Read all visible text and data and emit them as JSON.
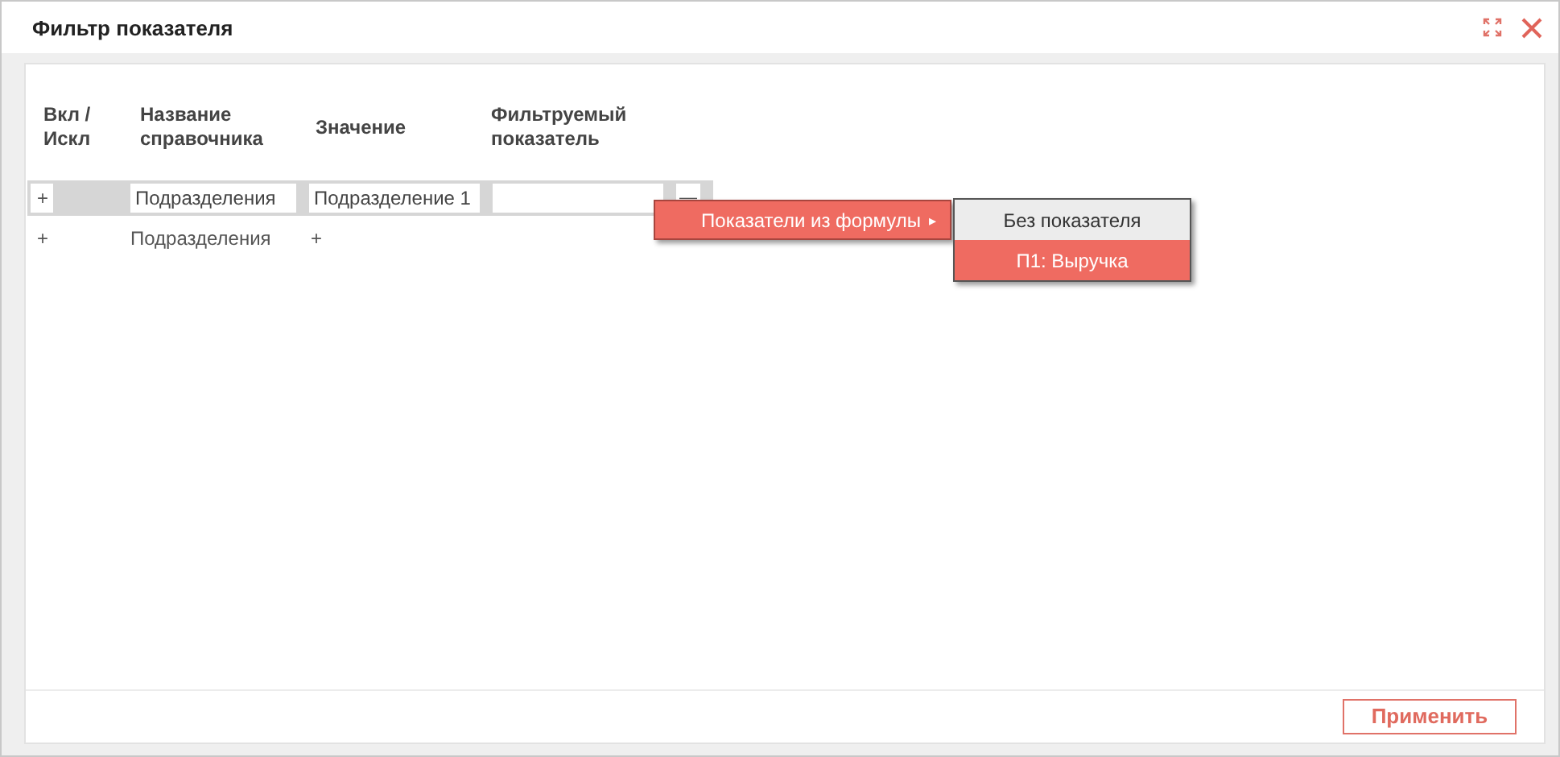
{
  "window": {
    "title": "Фильтр показателя"
  },
  "table": {
    "columns": [
      "Вкл / Искл",
      "Название справочника",
      "Значение",
      "Фильтруемый показатель"
    ],
    "rows": [
      {
        "kind": "edit",
        "toggle": "+",
        "directory": "Подразделения",
        "value": "Подразделение 1",
        "indicator": "",
        "remove": "—"
      },
      {
        "kind": "add",
        "toggle": "+",
        "directory": "Подразделения",
        "value": "+"
      }
    ]
  },
  "context_menu": {
    "label": "Показатели из формулы",
    "arrow": "▸",
    "submenu": [
      {
        "label": "Без показателя",
        "selected": false
      },
      {
        "label": "П1: Выручка",
        "selected": true
      }
    ]
  },
  "footer": {
    "apply_button": "Применить"
  }
}
